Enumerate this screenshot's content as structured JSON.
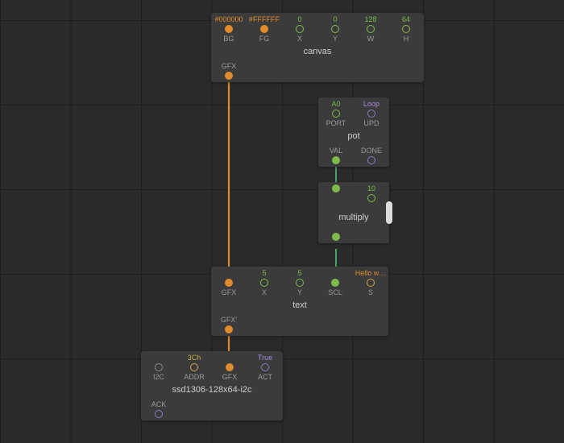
{
  "nodes": {
    "canvas": {
      "title": "canvas",
      "inputs": {
        "bg": {
          "label": "BG",
          "value": "#000000"
        },
        "fg": {
          "label": "FG",
          "value": "#FFFFFF"
        },
        "x": {
          "label": "X",
          "value": "0"
        },
        "y": {
          "label": "Y",
          "value": "0"
        },
        "w": {
          "label": "W",
          "value": "128"
        },
        "h": {
          "label": "H",
          "value": "64"
        }
      },
      "outputs": {
        "gfx": {
          "label": "GFX"
        }
      }
    },
    "pot": {
      "title": "pot",
      "inputs": {
        "port": {
          "label": "PORT",
          "value": "A0"
        },
        "upd": {
          "label": "UPD",
          "value": "Loop"
        }
      },
      "outputs": {
        "val": {
          "label": "VAL"
        },
        "done": {
          "label": "DONE"
        }
      }
    },
    "multiply": {
      "title": "multiply",
      "inputs": {
        "a": {
          "label": "",
          "value": ""
        },
        "b": {
          "label": "",
          "value": "10"
        }
      },
      "outputs": {
        "out": {
          "label": ""
        }
      }
    },
    "text": {
      "title": "text",
      "inputs": {
        "gfx": {
          "label": "GFX"
        },
        "x": {
          "label": "X",
          "value": "5"
        },
        "y": {
          "label": "Y",
          "value": "5"
        },
        "scl": {
          "label": "SCL"
        },
        "s": {
          "label": "S",
          "value": "Hello w…"
        }
      },
      "outputs": {
        "gfx": {
          "label": "GFX'"
        }
      }
    },
    "ssd1306": {
      "title": "ssd1306-128x64-i2c",
      "inputs": {
        "i2c": {
          "label": "I2C"
        },
        "addr": {
          "label": "ADDR",
          "value": "3Ch"
        },
        "gfx": {
          "label": "GFX"
        },
        "act": {
          "label": "ACT",
          "value": "True"
        }
      },
      "outputs": {
        "ack": {
          "label": "ACK"
        }
      }
    }
  }
}
